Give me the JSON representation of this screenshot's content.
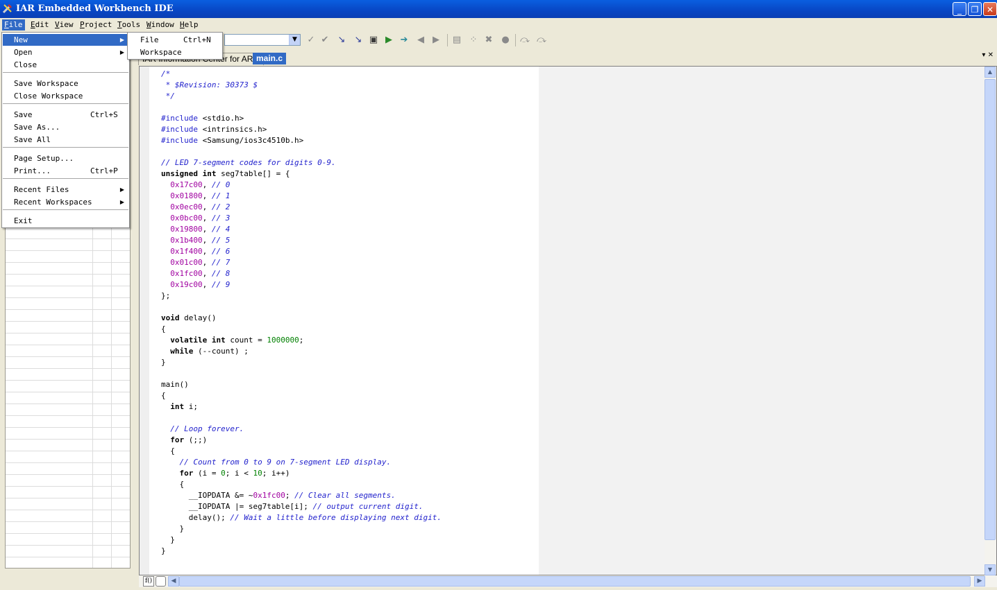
{
  "window": {
    "title": "IAR Embedded Workbench IDE",
    "minimize_glyph": "_",
    "restore_glyph": "❐",
    "close_glyph": "✕"
  },
  "menubar": {
    "items": [
      {
        "label": "File",
        "accel": "F"
      },
      {
        "label": "Edit",
        "accel": "E"
      },
      {
        "label": "View",
        "accel": "V"
      },
      {
        "label": "Project",
        "accel": "P"
      },
      {
        "label": "Tools",
        "accel": "T"
      },
      {
        "label": "Window",
        "accel": "W"
      },
      {
        "label": "Help",
        "accel": "H"
      }
    ]
  },
  "file_menu": {
    "items": [
      {
        "label": "New",
        "shortcut": "",
        "submenu": true,
        "highlighted": true
      },
      {
        "label": "Open",
        "shortcut": "",
        "submenu": true
      },
      {
        "label": "Close",
        "shortcut": ""
      },
      {
        "label": "Save Workspace",
        "shortcut": ""
      },
      {
        "label": "Close Workspace",
        "shortcut": ""
      },
      {
        "label": "Save",
        "shortcut": "Ctrl+S"
      },
      {
        "label": "Save As...",
        "shortcut": ""
      },
      {
        "label": "Save All",
        "shortcut": ""
      },
      {
        "label": "Page Setup...",
        "shortcut": ""
      },
      {
        "label": "Print...",
        "shortcut": "Ctrl+P"
      },
      {
        "label": "Recent Files",
        "shortcut": "",
        "submenu": true
      },
      {
        "label": "Recent Workspaces",
        "shortcut": "",
        "submenu": true
      },
      {
        "label": "Exit",
        "shortcut": ""
      }
    ]
  },
  "new_submenu": {
    "items": [
      {
        "label": "File",
        "shortcut": "Ctrl+N"
      },
      {
        "label": "Workspace",
        "shortcut": ""
      }
    ]
  },
  "tabs": {
    "info_center": "IAR Information Center for ARM",
    "main_c": "main.c",
    "close_glyph": "▾ ✕"
  },
  "editor": {
    "lines": [
      [
        [
          "cmt",
          "/*"
        ]
      ],
      [
        [
          "cmt",
          " * $Revision: 30373 $"
        ]
      ],
      [
        [
          "cmt",
          " */"
        ]
      ],
      [],
      [
        [
          "pp",
          "#include"
        ],
        [
          "txt",
          " <stdio.h>"
        ]
      ],
      [
        [
          "pp",
          "#include"
        ],
        [
          "txt",
          " <intrinsics.h>"
        ]
      ],
      [
        [
          "pp",
          "#include"
        ],
        [
          "txt",
          " <Samsung/ios3c4510b.h>"
        ]
      ],
      [],
      [
        [
          "cmt",
          "// LED 7-segment codes for digits 0-9."
        ]
      ],
      [
        [
          "kw",
          "unsigned int"
        ],
        [
          "txt",
          " seg7table[] = {"
        ]
      ],
      [
        [
          "txt",
          "  "
        ],
        [
          "num",
          "0x17c00"
        ],
        [
          "txt",
          ", "
        ],
        [
          "cmt",
          "// 0"
        ]
      ],
      [
        [
          "txt",
          "  "
        ],
        [
          "num",
          "0x01800"
        ],
        [
          "txt",
          ", "
        ],
        [
          "cmt",
          "// 1"
        ]
      ],
      [
        [
          "txt",
          "  "
        ],
        [
          "num",
          "0x0ec00"
        ],
        [
          "txt",
          ", "
        ],
        [
          "cmt",
          "// 2"
        ]
      ],
      [
        [
          "txt",
          "  "
        ],
        [
          "num",
          "0x0bc00"
        ],
        [
          "txt",
          ", "
        ],
        [
          "cmt",
          "// 3"
        ]
      ],
      [
        [
          "txt",
          "  "
        ],
        [
          "num",
          "0x19800"
        ],
        [
          "txt",
          ", "
        ],
        [
          "cmt",
          "// 4"
        ]
      ],
      [
        [
          "txt",
          "  "
        ],
        [
          "num",
          "0x1b400"
        ],
        [
          "txt",
          ", "
        ],
        [
          "cmt",
          "// 5"
        ]
      ],
      [
        [
          "txt",
          "  "
        ],
        [
          "num",
          "0x1f400"
        ],
        [
          "txt",
          ", "
        ],
        [
          "cmt",
          "// 6"
        ]
      ],
      [
        [
          "txt",
          "  "
        ],
        [
          "num",
          "0x01c00"
        ],
        [
          "txt",
          ", "
        ],
        [
          "cmt",
          "// 7"
        ]
      ],
      [
        [
          "txt",
          "  "
        ],
        [
          "num",
          "0x1fc00"
        ],
        [
          "txt",
          ", "
        ],
        [
          "cmt",
          "// 8"
        ]
      ],
      [
        [
          "txt",
          "  "
        ],
        [
          "num",
          "0x19c00"
        ],
        [
          "txt",
          ", "
        ],
        [
          "cmt",
          "// 9"
        ]
      ],
      [
        [
          "txt",
          "};"
        ]
      ],
      [],
      [
        [
          "kw",
          "void"
        ],
        [
          "txt",
          " delay()"
        ]
      ],
      [
        [
          "txt",
          "{"
        ]
      ],
      [
        [
          "txt",
          "  "
        ],
        [
          "kw",
          "volatile int"
        ],
        [
          "txt",
          " count = "
        ],
        [
          "num2",
          "1000000"
        ],
        [
          "txt",
          ";"
        ]
      ],
      [
        [
          "txt",
          "  "
        ],
        [
          "kw",
          "while"
        ],
        [
          "txt",
          " (--count) ;"
        ]
      ],
      [
        [
          "txt",
          "}"
        ]
      ],
      [],
      [
        [
          "txt",
          "main()"
        ]
      ],
      [
        [
          "txt",
          "{"
        ]
      ],
      [
        [
          "txt",
          "  "
        ],
        [
          "kw",
          "int"
        ],
        [
          "txt",
          " i;"
        ]
      ],
      [],
      [
        [
          "txt",
          "  "
        ],
        [
          "cmt",
          "// Loop forever."
        ]
      ],
      [
        [
          "txt",
          "  "
        ],
        [
          "kw",
          "for"
        ],
        [
          "txt",
          " (;;)"
        ]
      ],
      [
        [
          "txt",
          "  {"
        ]
      ],
      [
        [
          "txt",
          "    "
        ],
        [
          "cmt",
          "// Count from 0 to 9 on 7-segment LED display."
        ]
      ],
      [
        [
          "txt",
          "    "
        ],
        [
          "kw",
          "for"
        ],
        [
          "txt",
          " (i = "
        ],
        [
          "num2",
          "0"
        ],
        [
          "txt",
          "; i < "
        ],
        [
          "num2",
          "10"
        ],
        [
          "txt",
          "; i++)"
        ]
      ],
      [
        [
          "txt",
          "    {"
        ]
      ],
      [
        [
          "txt",
          "      __IOPDATA &= ~"
        ],
        [
          "num",
          "0x1fc00"
        ],
        [
          "txt",
          "; "
        ],
        [
          "cmt",
          "// Clear all segments."
        ]
      ],
      [
        [
          "txt",
          "      __IOPDATA |= seg7table[i]; "
        ],
        [
          "cmt",
          "// output current digit."
        ]
      ],
      [
        [
          "txt",
          "      delay(); "
        ],
        [
          "cmt",
          "// Wait a little before displaying next digit."
        ]
      ],
      [
        [
          "txt",
          "    }"
        ]
      ],
      [
        [
          "txt",
          "  }"
        ]
      ],
      [
        [
          "txt",
          "}"
        ]
      ]
    ]
  },
  "statusbar": {
    "func_button": "f()"
  },
  "icons": {
    "app": "iar-tools-icon",
    "toolbar": [
      "make-icon",
      "compile-icon",
      "debug-icon",
      "debug-without-download-icon",
      "check-icon",
      "go-icon",
      "step-over-icon",
      "back-icon",
      "forward-icon",
      "template-icon",
      "breakpoint-icon",
      "toggle-breakpoint-icon",
      "stop-icon",
      "step-icon",
      "step-out-icon"
    ]
  }
}
